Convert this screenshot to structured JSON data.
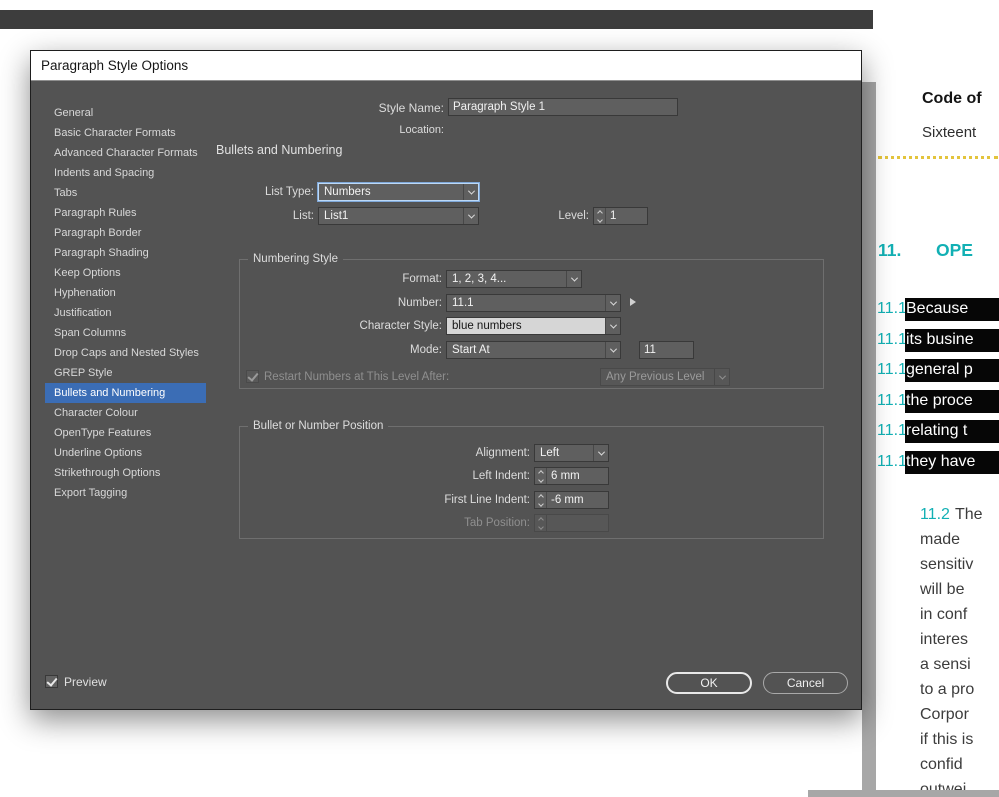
{
  "colors": {
    "dialog_bg": "#535353",
    "accent_blue": "#3b6db5",
    "teal": "#12b0b4",
    "dot_yellow": "#e3c43c"
  },
  "icons": {
    "dropdown": "chevron-down",
    "stepper": "up-down-chevrons",
    "flyout": "right-triangle",
    "checkbox_check": "checkmark"
  },
  "dialog": {
    "title": "Paragraph Style Options",
    "sidebar": {
      "items": [
        "General",
        "Basic Character Formats",
        "Advanced Character Formats",
        "Indents and Spacing",
        "Tabs",
        "Paragraph Rules",
        "Paragraph Border",
        "Paragraph Shading",
        "Keep Options",
        "Hyphenation",
        "Justification",
        "Span Columns",
        "Drop Caps and Nested Styles",
        "GREP Style",
        "Bullets and Numbering",
        "Character Colour",
        "OpenType Features",
        "Underline Options",
        "Strikethrough Options",
        "Export Tagging"
      ],
      "selected": "Bullets and Numbering"
    },
    "header": {
      "style_name_label": "Style Name:",
      "style_name_value": "Paragraph Style 1",
      "location_label": "Location:",
      "panel_title": "Bullets and Numbering"
    },
    "list_controls": {
      "list_type_label": "List Type:",
      "list_type_value": "Numbers",
      "list_label": "List:",
      "list_value": "List1",
      "level_label": "Level:",
      "level_value": "1"
    },
    "numbering_style": {
      "group_title": "Numbering Style",
      "format_label": "Format:",
      "format_value": "1, 2, 3, 4...",
      "number_label": "Number:",
      "number_value": "11.1",
      "character_style_label": "Character Style:",
      "character_style_value": "blue numbers",
      "mode_label": "Mode:",
      "mode_value": "Start At",
      "mode_start_value": "11",
      "restart_label": "Restart Numbers at This Level After:",
      "restart_value": "Any Previous Level"
    },
    "position": {
      "group_title": "Bullet or Number Position",
      "alignment_label": "Alignment:",
      "alignment_value": "Left",
      "left_indent_label": "Left Indent:",
      "left_indent_value": "6 mm",
      "first_line_indent_label": "First Line Indent:",
      "first_line_indent_value": "-6 mm",
      "tab_position_label": "Tab Position:"
    },
    "footer": {
      "preview_label": "Preview",
      "ok_label": "OK",
      "cancel_label": "Cancel"
    }
  },
  "document": {
    "heading_bold": "Code of",
    "subheading": "Sixteent",
    "section_number": "11.",
    "section_title": "OPE",
    "numbered_items": [
      {
        "num": "11.1",
        "text": "Because"
      },
      {
        "num": "11.1",
        "text": "its busine"
      },
      {
        "num": "11.1",
        "text": "general p"
      },
      {
        "num": "11.1",
        "text": "the proce"
      },
      {
        "num": "11.1",
        "text": "relating t"
      },
      {
        "num": "11.1",
        "text": "they have"
      }
    ],
    "para_11_2": {
      "num": "11.2",
      "first_line": "The",
      "lines": [
        "made",
        "sensitiv",
        "will be",
        "in conf",
        "interes",
        "a sensi",
        "to a pro",
        "Corpor",
        "if this is",
        "confid",
        "outwei"
      ]
    }
  }
}
